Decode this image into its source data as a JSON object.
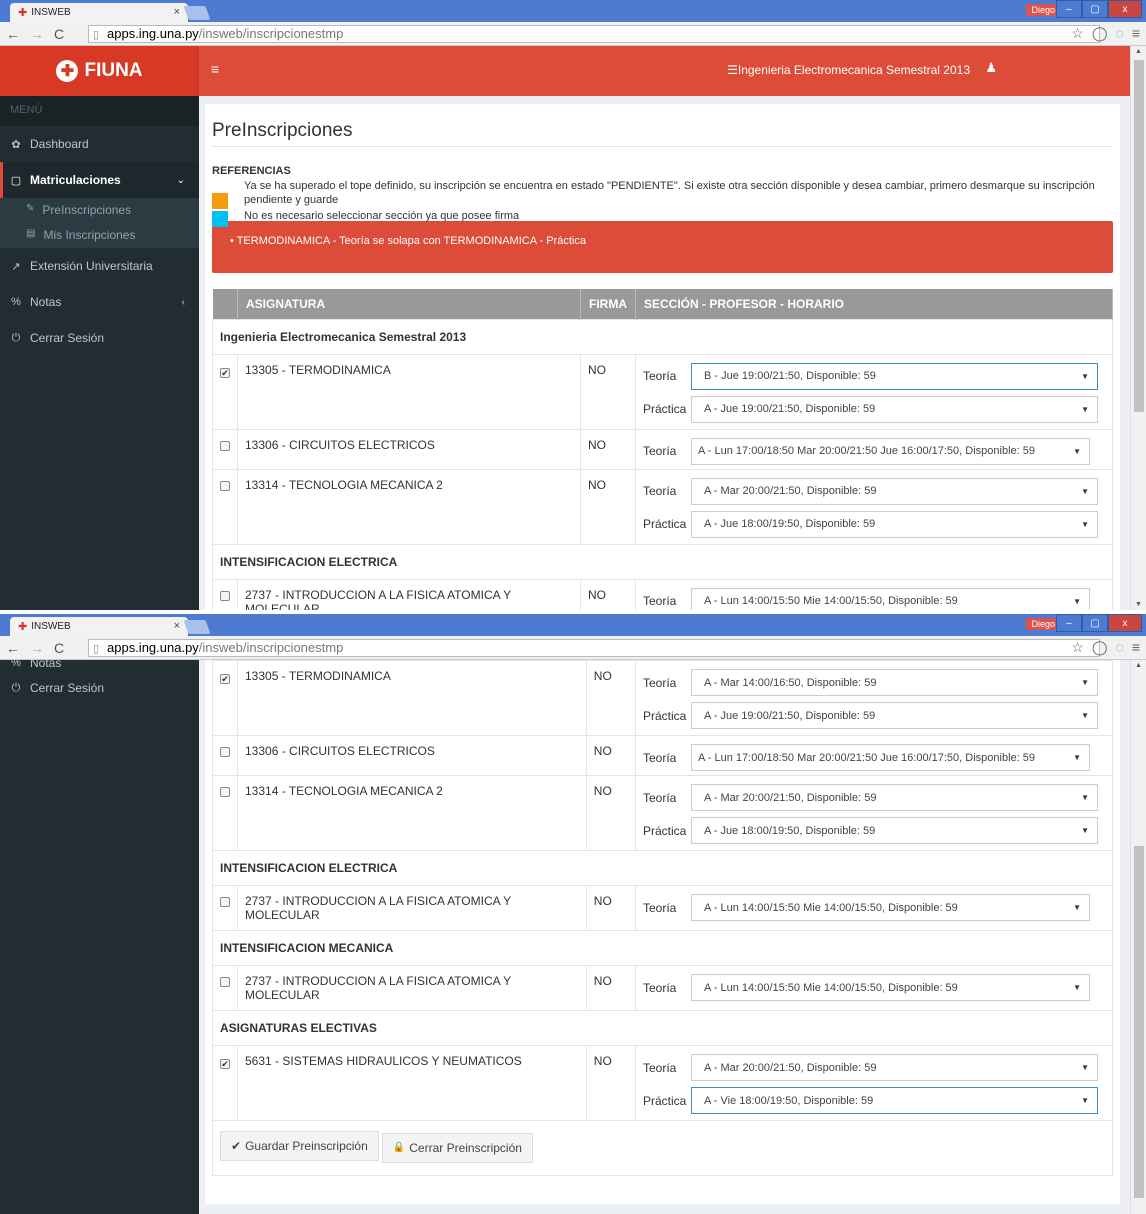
{
  "browser": {
    "tab_title": "INSWEB",
    "tab_close": "×",
    "user": "Diego",
    "win_min": "–",
    "win_max": "▢",
    "win_close": "x",
    "url_host": "apps.ing.una.py",
    "url_path": "/insweb/inscripcionestmp",
    "back": "←",
    "forward": "→",
    "reload": "C",
    "star": "☆",
    "ext1": "◯",
    "ext2": "◌",
    "menu": "≡"
  },
  "brand": {
    "name": "FIUNA",
    "logo": "✚"
  },
  "topbar": {
    "hamburger": "≡",
    "career": "☰Ingenieria Electromecanica Semestral 2013",
    "user_icon": "♟"
  },
  "sidebar": {
    "menu_head": "MENÚ",
    "items": [
      {
        "icon": "✿",
        "label": "Dashboard"
      },
      {
        "icon": "▢",
        "label": "Matriculaciones",
        "caret": "⌄"
      },
      {
        "icon": "↗",
        "label": "Extensión Universitaria"
      },
      {
        "icon": "%",
        "label": "Notas",
        "caret": "‹"
      },
      {
        "icon": "⏻",
        "label": "Cerrar Sesión"
      }
    ],
    "sub": [
      {
        "icon": "✎",
        "label": "PreInscripciones"
      },
      {
        "icon": "▤",
        "label": "Mis Inscripciones"
      }
    ]
  },
  "page": {
    "title": "PreInscripciones",
    "ref_title": "REFERENCIAS",
    "ref1": "Ya se ha superado el tope definido, su inscripción se encuentra en estado \"PENDIENTE\". Si existe otra sección disponible y desea cambiar, primero desmarque su inscripción pendiente y guarde",
    "ref2": "No es necesario seleccionar sección ya que posee firma",
    "ref1_color": "#f39c12",
    "ref2_color": "#00c0ef",
    "alert": "• TERMODINAMICA - Teoría se solapa con TERMODINAMICA - Práctica",
    "col_asignatura": "ASIGNATURA",
    "col_firma": "FIRMA",
    "col_seccion": "SECCIÓN - PROFESOR - HORARIO",
    "teoria": "Teoría",
    "practica": "Práctica",
    "dd": "▼"
  },
  "groups": {
    "g1": "Ingenieria Electromecanica Semestral 2013",
    "g2": "INTENSIFICACION ELECTRICA",
    "g3": "INTENSIFICACION MECANICA",
    "g4": "ASIGNATURAS ELECTIVAS"
  },
  "rows": {
    "r1": {
      "name": "13305 - TERMODINAMICA",
      "firma": "NO",
      "check": "✔",
      "teoria_w1": "B - Jue 19:00/21:50, Disponible: 59",
      "teoria_w2": "A - Mar 14:00/16:50, Disponible: 59",
      "practica": "A - Jue 19:00/21:50, Disponible: 59"
    },
    "r2": {
      "name": "13306 - CIRCUITOS ELECTRICOS",
      "firma": "NO",
      "teoria": "A - Lun 17:00/18:50 Mar 20:00/21:50 Jue 16:00/17:50, Disponible: 59"
    },
    "r3": {
      "name": "13314 - TECNOLOGIA MECANICA 2",
      "firma": "NO",
      "teoria": "A - Mar 20:00/21:50, Disponible: 59",
      "practica": "A - Jue 18:00/19:50, Disponible: 59"
    },
    "r4": {
      "name": "2737 - INTRODUCCION A LA FISICA ATOMICA Y MOLECULAR",
      "firma": "NO",
      "teoria": "A - Lun 14:00/15:50 Mie 14:00/15:50, Disponible: 59"
    },
    "r5": {
      "name": "2737 - INTRODUCCION A LA FISICA ATOMICA Y MOLECULAR",
      "firma": "NO",
      "teoria": "A - Lun 14:00/15:50 Mie 14:00/15:50, Disponible: 59"
    },
    "r6": {
      "name": "5631 - SISTEMAS HIDRAULICOS Y NEUMATICOS",
      "firma": "NO",
      "check": "✔",
      "teoria": "A - Mar 20:00/21:50, Disponible: 59",
      "practica": "A - Vie 18:00/19:50, Disponible: 59"
    }
  },
  "buttons": {
    "save_icon": "✔",
    "save": "Guardar Preinscripción",
    "close_icon": "🔒",
    "close": "Cerrar Preinscripción"
  }
}
